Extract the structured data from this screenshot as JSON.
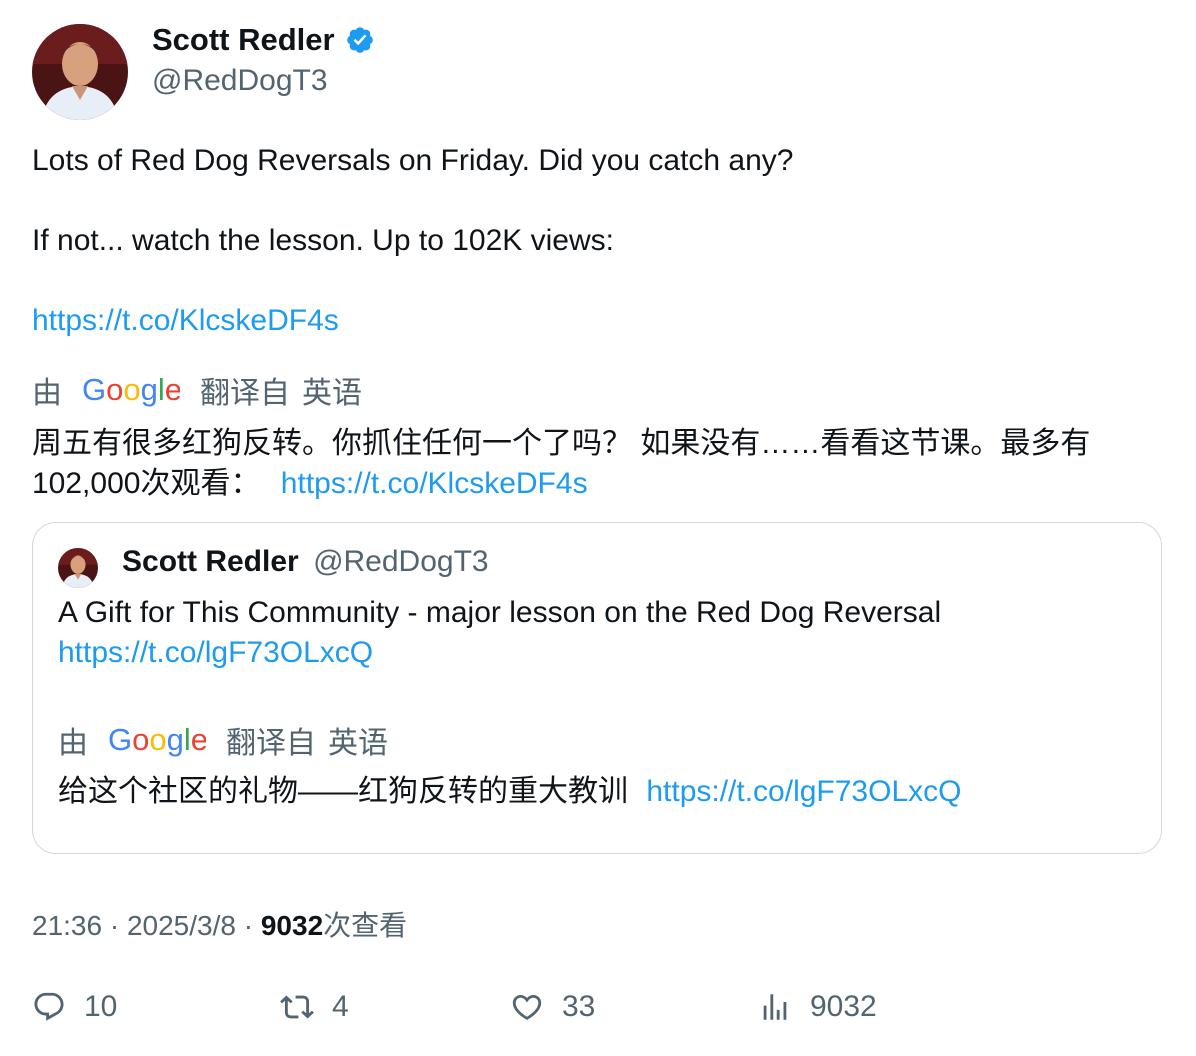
{
  "author": {
    "name": "Scott Redler",
    "handle": "@RedDogT3"
  },
  "tweet": {
    "line1": "Lots of Red Dog Reversals on Friday. Did you catch any?",
    "line2": "If not... watch the lesson. Up to 102K views:",
    "link": "https://t.co/KlcskeDF4s"
  },
  "translation": {
    "by": "由",
    "brand": "Google",
    "from": "翻译自",
    "language": "英语",
    "line1": "周五有很多红狗反转。你抓住任何一个了吗？ 如果没有……看看这节课。最多有",
    "line2": "102,000次观看：",
    "link": "https://t.co/KlcskeDF4s"
  },
  "quote": {
    "name": "Scott Redler",
    "handle": "@RedDogT3",
    "text": "A Gift for This Community - major lesson on the Red Dog Reversal",
    "link": "https://t.co/lgF73OLxcQ",
    "translation": {
      "by": "由",
      "brand": "Google",
      "from": "翻译自",
      "language": "英语",
      "text": "给这个社区的礼物——红狗反转的重大教训",
      "link": "https://t.co/lgF73OLxcQ"
    }
  },
  "meta": {
    "time": "21:36",
    "date": "2025/3/8",
    "views": "9032",
    "views_label": "次查看",
    "separator": "·"
  },
  "actions": {
    "replies": "10",
    "retweets": "4",
    "likes": "33",
    "views": "9032"
  },
  "colors": {
    "link": "#1d9bf0",
    "secondary": "#536471",
    "verified": "#1d9bf0"
  }
}
